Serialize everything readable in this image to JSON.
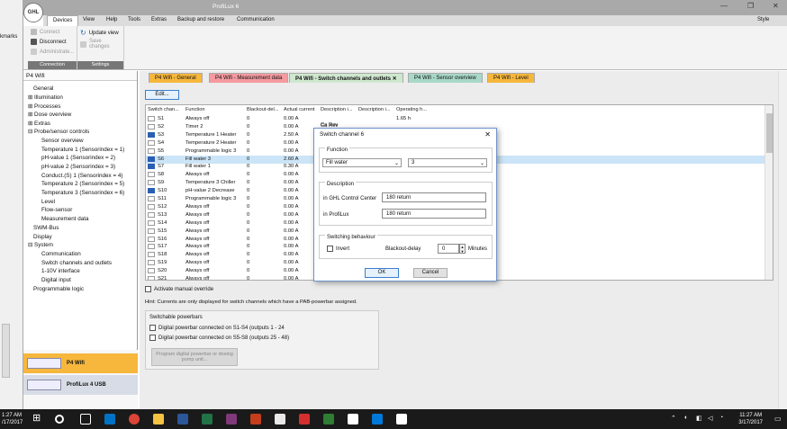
{
  "window": {
    "title": "ProfiLux 6",
    "style_label": "Style",
    "sidebar_fragment": "kmarks"
  },
  "logo_text": "GHL",
  "menu": [
    "Devices",
    "View",
    "Help",
    "Tools",
    "Extras",
    "Backup and restore",
    "Communication"
  ],
  "ribbon": {
    "connect": "Connect",
    "disconnect": "Disconnect",
    "administrate": "Administrate...",
    "connection_group": "Connection",
    "update_view": "Update view",
    "save_changes": "Save changes",
    "settings_group": "Settings"
  },
  "nav": {
    "header": "P4 Wifi",
    "items": [
      "General",
      "Illumination",
      "Processes",
      "Dose overview",
      "Extras",
      "Probe/sensor controls",
      "Sensor overview",
      "Temperature 1 (Sensorindex = 1)",
      "pH-value 1 (Sensorindex = 2)",
      "pH-value 2 (Sensorindex = 3)",
      "Conduct.(S) 1 (Sensorindex = 4)",
      "Temperature 2 (Sensorindex = 5)",
      "Temperature 3 (Sensorindex = 6)",
      "Level",
      "Flow-sensor",
      "Measurement data",
      "SWM-Bus",
      "Display",
      "System",
      "Communication",
      "Switch channels and outlets",
      "1-10V interface",
      "Digital input",
      "Programmable logic"
    ],
    "devices": [
      "P4 Wifi",
      "ProfiLux 4 USB"
    ]
  },
  "tabs": [
    "P4 Wifi - General",
    "P4 Wifi - Measurement data",
    "P4 Wifi - Switch channels and outlets",
    "P4 Wifi - Sensor overview",
    "P4 Wifi - Level"
  ],
  "tab_colors": [
    "#f6b73c",
    "#f49aa0",
    "#cfe7cf",
    "#a8d8c8",
    "#f6b73c"
  ],
  "edit_button": "Edit...",
  "grid": {
    "headers": [
      "Switch chan...",
      "Function",
      "Blackout-del...",
      "Actual current",
      "Description i...",
      "Description i...",
      "Operating h..."
    ],
    "rows": [
      {
        "ch": "S1",
        "fn": "Always off",
        "bd": "0",
        "cur": "0.00 A",
        "d1": "",
        "d2": "",
        "op": "1.65 h",
        "on": false
      },
      {
        "ch": "S2",
        "fn": "Timer 2",
        "bd": "0",
        "cur": "0.00 A",
        "d1": "",
        "d2": "",
        "op": "",
        "on": false
      },
      {
        "ch": "S3",
        "fn": "Temperature 1 Heater",
        "bd": "0",
        "cur": "2.50 A",
        "d1": "",
        "d2": "",
        "op": "",
        "on": true
      },
      {
        "ch": "S4",
        "fn": "Temperature 2 Heater",
        "bd": "0",
        "cur": "0.00 A",
        "d1": "",
        "d2": "",
        "op": "",
        "on": false
      },
      {
        "ch": "S5",
        "fn": "Programmable logic 3",
        "bd": "0",
        "cur": "0.00 A",
        "d1": "",
        "d2": "",
        "op": "",
        "on": false
      },
      {
        "ch": "S6",
        "fn": "Fill water 3",
        "bd": "0",
        "cur": "2.60 A",
        "d1": "",
        "d2": "",
        "op": "",
        "on": true
      },
      {
        "ch": "S7",
        "fn": "Fill water 1",
        "bd": "0",
        "cur": "0.30 A",
        "d1": "",
        "d2": "",
        "op": "",
        "on": true
      },
      {
        "ch": "S8",
        "fn": "Always off",
        "bd": "0",
        "cur": "0.00 A",
        "d1": "",
        "d2": "",
        "op": "",
        "on": false
      },
      {
        "ch": "S9",
        "fn": "Temperature 3 Chiller",
        "bd": "0",
        "cur": "0.00 A",
        "d1": "",
        "d2": "",
        "op": "",
        "on": false
      },
      {
        "ch": "S10",
        "fn": "pH-value 2 Decrease",
        "bd": "0",
        "cur": "0.00 A",
        "d1": "",
        "d2": "",
        "op": "",
        "on": true
      },
      {
        "ch": "S11",
        "fn": "Programmable logic 3",
        "bd": "0",
        "cur": "0.00 A",
        "d1": "",
        "d2": "",
        "op": "",
        "on": false
      },
      {
        "ch": "S12",
        "fn": "Always off",
        "bd": "0",
        "cur": "0.00 A",
        "d1": "",
        "d2": "",
        "op": "",
        "on": false
      },
      {
        "ch": "S13",
        "fn": "Always off",
        "bd": "0",
        "cur": "0.00 A",
        "d1": "",
        "d2": "",
        "op": "",
        "on": false
      },
      {
        "ch": "S14",
        "fn": "Always off",
        "bd": "0",
        "cur": "0.00 A",
        "d1": "",
        "d2": "",
        "op": "",
        "on": false
      },
      {
        "ch": "S15",
        "fn": "Always off",
        "bd": "0",
        "cur": "0.00 A",
        "d1": "",
        "d2": "",
        "op": "",
        "on": false
      },
      {
        "ch": "S16",
        "fn": "Always off",
        "bd": "0",
        "cur": "0.00 A",
        "d1": "",
        "d2": "",
        "op": "",
        "on": false
      },
      {
        "ch": "S17",
        "fn": "Always off",
        "bd": "0",
        "cur": "0.00 A",
        "d1": "",
        "d2": "",
        "op": "",
        "on": false
      },
      {
        "ch": "S18",
        "fn": "Always off",
        "bd": "0",
        "cur": "0.00 A",
        "d1": "",
        "d2": "",
        "op": "",
        "on": false
      },
      {
        "ch": "S19",
        "fn": "Always off",
        "bd": "0",
        "cur": "0.00 A",
        "d1": "",
        "d2": "",
        "op": "",
        "on": false
      },
      {
        "ch": "S20",
        "fn": "Always off",
        "bd": "0",
        "cur": "0.00 A",
        "d1": "",
        "d2": "",
        "op": "",
        "on": false
      },
      {
        "ch": "S21",
        "fn": "Always off",
        "bd": "0",
        "cur": "0.00 A",
        "d1": "",
        "d2": "",
        "op": "",
        "on": false
      }
    ],
    "desc_partial": [
      "Ca Rev",
      "Ca Rev"
    ]
  },
  "manual_override": "Activate manual override",
  "hint": "Hint: Currents are only displayed for switch channels which have a PAB-powerbar assigned.",
  "powerbars": {
    "title": "Switchable powerbars",
    "pb1": "Digital powerbar connected on   S1-S4 (outputs 1 - 24",
    "pb2": "Digital powerbar connected on   S5-S8 (outputs 25 - 48)",
    "program_btn": "Program digital powerbar or dosing pump unit..."
  },
  "dialog": {
    "title": "Switch channel 6",
    "function_label": "Function",
    "function_value": "Fill water",
    "function_index": "3",
    "description_label": "Description",
    "ghl_label": "in GHL Control Center",
    "ghl_value": "180 return",
    "profilux_label": "in ProfiLux",
    "profilux_value": "180 return",
    "switching_label": "Switching behaviour",
    "invert_label": "Invert",
    "blackout_label": "Blackout-delay",
    "blackout_value": "0",
    "minutes_label": "Minutes",
    "ok": "OK",
    "cancel": "Cancel"
  },
  "taskbar": {
    "time": "11:27 AM",
    "date": "3/17/2017",
    "time_left": "1:27 AM",
    "date_left": "/17/2017"
  }
}
